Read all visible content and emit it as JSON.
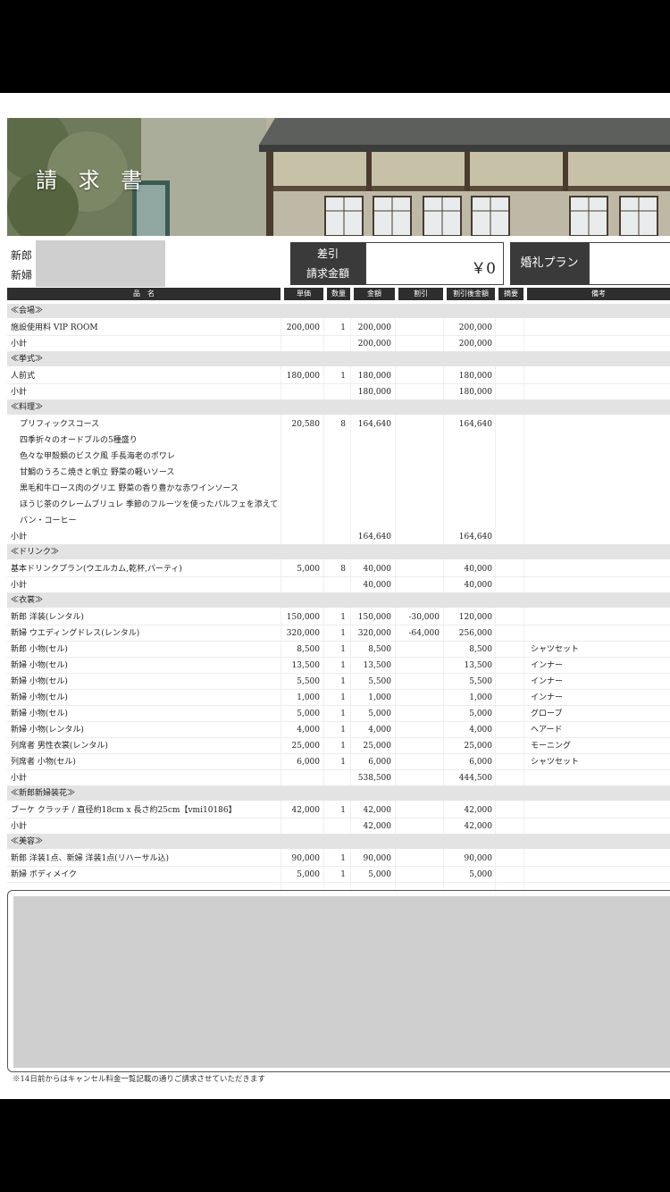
{
  "header": {
    "title": "請 求 書"
  },
  "info": {
    "groom_label": "新郎",
    "bride_label": "新婦",
    "discount_label": "差引",
    "billing_label": "請求金額",
    "amount": "￥0",
    "plan_label": "婚礼プラン"
  },
  "columns": {
    "name": "品　名",
    "unit": "単価",
    "qty": "数量",
    "amount": "金額",
    "discount": "割引",
    "after": "割引後金額",
    "summary": "摘要",
    "note": "備考"
  },
  "rows": [
    {
      "name": "≪会場≫",
      "kind": "section"
    },
    {
      "name": "施設使用料 VIP ROOM",
      "unit": "200,000",
      "qty": "1",
      "amount": "200,000",
      "after": "200,000"
    },
    {
      "name": "小計",
      "amount": "200,000",
      "after": "200,000",
      "kind": "sub"
    },
    {
      "name": "≪挙式≫",
      "kind": "section"
    },
    {
      "name": "人前式",
      "unit": "180,000",
      "qty": "1",
      "amount": "180,000",
      "after": "180,000"
    },
    {
      "name": "小計",
      "amount": "180,000",
      "after": "180,000",
      "kind": "sub"
    },
    {
      "name": "≪料理≫",
      "kind": "section"
    },
    {
      "name": "プリフィックスコース",
      "unit": "20,580",
      "qty": "8",
      "amount": "164,640",
      "after": "164,640",
      "kind": "course"
    },
    {
      "name": "四季折々のオードブルの5種盛り",
      "kind": "course-item"
    },
    {
      "name": "色々な甲殻類のビスク風 手長海老のポワレ",
      "kind": "course-item"
    },
    {
      "name": "甘鯛のうろこ焼きと帆立 野菜の軽いソース",
      "kind": "course-item"
    },
    {
      "name": "黒毛和牛ロース肉のグリエ 野菜の香り豊かな赤ワインソース",
      "kind": "course-item"
    },
    {
      "name": "ほうじ茶のクレームブリュレ 季節のフルーツを使ったパルフェを添えて",
      "kind": "course-item"
    },
    {
      "name": "パン・コーヒー",
      "kind": "course-item"
    },
    {
      "name": "小計",
      "amount": "164,640",
      "after": "164,640",
      "kind": "sub"
    },
    {
      "name": "≪ドリンク≫",
      "kind": "section"
    },
    {
      "name": "基本ドリンクプラン(ウエルカム,乾杯,パーティ)",
      "unit": "5,000",
      "qty": "8",
      "amount": "40,000",
      "after": "40,000"
    },
    {
      "name": "小計",
      "amount": "40,000",
      "after": "40,000",
      "kind": "sub"
    },
    {
      "name": "≪衣裳≫",
      "kind": "section"
    },
    {
      "name": "新郎 洋装(レンタル)",
      "unit": "150,000",
      "qty": "1",
      "amount": "150,000",
      "discount": "-30,000",
      "after": "120,000"
    },
    {
      "name": "新婦 ウエディングドレス(レンタル)",
      "unit": "320,000",
      "qty": "1",
      "amount": "320,000",
      "discount": "-64,000",
      "after": "256,000"
    },
    {
      "name": "新郎 小物(セル)",
      "unit": "8,500",
      "qty": "1",
      "amount": "8,500",
      "after": "8,500",
      "note": "シャツセット"
    },
    {
      "name": "新婦 小物(セル)",
      "unit": "13,500",
      "qty": "1",
      "amount": "13,500",
      "after": "13,500",
      "note": "インナー"
    },
    {
      "name": "新婦 小物(セル)",
      "unit": "5,500",
      "qty": "1",
      "amount": "5,500",
      "after": "5,500",
      "note": "インナー"
    },
    {
      "name": "新婦 小物(セル)",
      "unit": "1,000",
      "qty": "1",
      "amount": "1,000",
      "after": "1,000",
      "note": "インナー"
    },
    {
      "name": "新婦 小物(セル)",
      "unit": "5,000",
      "qty": "1",
      "amount": "5,000",
      "after": "5,000",
      "note": "グローブ"
    },
    {
      "name": "新婦 小物(レンタル)",
      "unit": "4,000",
      "qty": "1",
      "amount": "4,000",
      "after": "4,000",
      "note": "ヘアード"
    },
    {
      "name": "列席者 男性衣裳(レンタル)",
      "unit": "25,000",
      "qty": "1",
      "amount": "25,000",
      "after": "25,000",
      "note": "モーニング"
    },
    {
      "name": "列席者 小物(セル)",
      "unit": "6,000",
      "qty": "1",
      "amount": "6,000",
      "after": "6,000",
      "note": "シャツセット"
    },
    {
      "name": "小計",
      "amount": "538,500",
      "after": "444,500",
      "kind": "sub"
    },
    {
      "name": "≪新郎新婦装花≫",
      "kind": "section"
    },
    {
      "name": "ブーケ クラッチ / 直径約18cm x 長さ約25cm【vmi10186】",
      "unit": "42,000",
      "qty": "1",
      "amount": "42,000",
      "after": "42,000"
    },
    {
      "name": "小計",
      "amount": "42,000",
      "after": "42,000",
      "kind": "sub"
    },
    {
      "name": "≪美容≫",
      "kind": "section"
    },
    {
      "name": "新郎 洋装1点、新婦 洋装1点(リハーサル込)",
      "unit": "90,000",
      "qty": "1",
      "amount": "90,000",
      "after": "90,000"
    },
    {
      "name": "新婦 ボディメイク",
      "unit": "5,000",
      "qty": "1",
      "amount": "5,000",
      "after": "5,000"
    }
  ],
  "footnote": "※14日前からはキャンセル料金一覧記載の通りご請求させていただきます"
}
